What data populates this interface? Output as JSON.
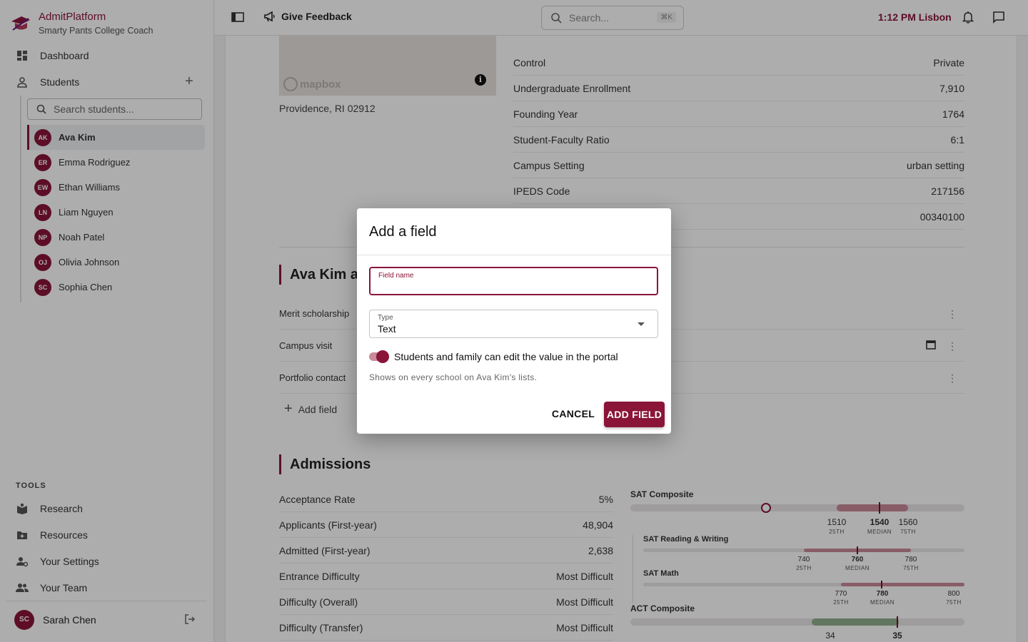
{
  "brand": {
    "title": "AdmitPlatform",
    "subtitle": "Smarty Pants College Coach"
  },
  "nav": {
    "dashboard": "Dashboard",
    "students": "Students"
  },
  "student_search": {
    "placeholder": "Search students..."
  },
  "students": [
    {
      "initials": "AK",
      "name": "Ava Kim",
      "active": true
    },
    {
      "initials": "ER",
      "name": "Emma Rodriguez"
    },
    {
      "initials": "EW",
      "name": "Ethan Williams"
    },
    {
      "initials": "LN",
      "name": "Liam Nguyen"
    },
    {
      "initials": "NP",
      "name": "Noah Patel"
    },
    {
      "initials": "OJ",
      "name": "Olivia Johnson"
    },
    {
      "initials": "SC",
      "name": "Sophia Chen"
    }
  ],
  "tools": {
    "label": "TOOLS",
    "items": [
      "Research",
      "Resources",
      "Your Settings",
      "Your Team"
    ]
  },
  "user": {
    "initials": "SC",
    "name": "Sarah Chen"
  },
  "topbar": {
    "feedback": "Give Feedback",
    "search_placeholder": "Search...",
    "search_shortcut": "⌘K",
    "time": "1:12 PM Lisbon"
  },
  "map": {
    "attribution": "mapbox",
    "info": "i"
  },
  "address": "Providence, RI 02912",
  "facts": [
    {
      "label": "Control",
      "value": "Private"
    },
    {
      "label": "Undergraduate Enrollment",
      "value": "7,910"
    },
    {
      "label": "Founding Year",
      "value": "1764"
    },
    {
      "label": "Student-Faculty Ratio",
      "value": "6:1"
    },
    {
      "label": "Campus Setting",
      "value": "urban setting"
    },
    {
      "label": "IPEDS Code",
      "value": "217156"
    },
    {
      "label": "",
      "value": "00340100"
    }
  ],
  "custom_section": {
    "title": "Ava Kim at",
    "rows": [
      "Merit scholarship",
      "Campus visit",
      "Portfolio contact"
    ],
    "add_label": "Add field"
  },
  "admissions": {
    "title": "Admissions",
    "rows": [
      {
        "label": "Acceptance Rate",
        "value": "5%"
      },
      {
        "label": "Applicants (First-year)",
        "value": "48,904"
      },
      {
        "label": "Admitted (First-year)",
        "value": "2,638"
      },
      {
        "label": "Entrance Difficulty",
        "value": "Most Difficult"
      },
      {
        "label": "Difficulty (Overall)",
        "value": "Most Difficult"
      },
      {
        "label": "Difficulty (Transfer)",
        "value": "Most Difficult"
      }
    ]
  },
  "scores": {
    "sat_composite": {
      "title": "SAT Composite",
      "p25": "1510",
      "median": "1540",
      "p75": "1560",
      "cap25": "25TH",
      "capMed": "MEDIAN",
      "cap75": "75TH"
    },
    "sat_rw": {
      "title": "SAT Reading & Writing",
      "p25": "740",
      "median": "760",
      "p75": "780"
    },
    "sat_math": {
      "title": "SAT Math",
      "p25": "770",
      "median": "780",
      "p75": "800"
    },
    "act": {
      "title": "ACT Composite",
      "p25": "34",
      "median": "35"
    }
  },
  "dialog": {
    "title": "Add a field",
    "field_name_label": "Field name",
    "type_label": "Type",
    "type_value": "Text",
    "toggle_label": "Students and family can edit the value in the portal",
    "helper": "Shows on every school on Ava Kim's lists.",
    "cancel": "CANCEL",
    "add": "ADD FIELD"
  }
}
